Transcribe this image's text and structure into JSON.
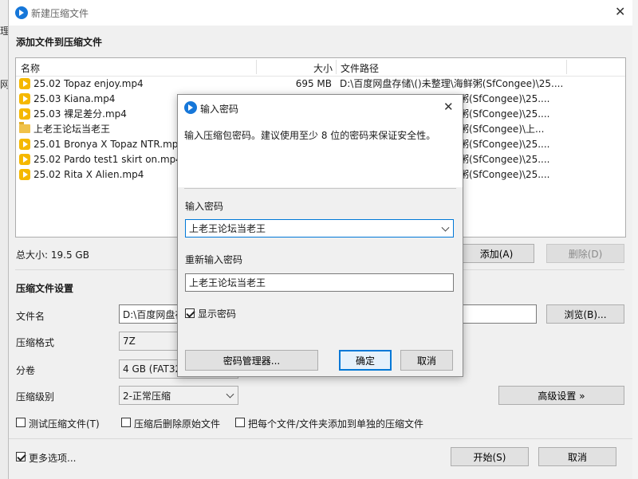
{
  "window": {
    "title": "新建压缩文件",
    "section_add_title": "添加文件到压缩文件",
    "columns": {
      "name": "名称",
      "size": "大小",
      "path": "文件路径"
    },
    "files": [
      {
        "name": "25.02 Topaz enjoy.mp4",
        "size": "695 MB",
        "path": "D:\\百度网盘存储\\()未整理\\海鲜粥(SfCongee)\\25....",
        "icon": "video-icon"
      },
      {
        "name": "25.03 Kiana.mp4",
        "size": "",
        "path": "粥(SfCongee)\\25....",
        "icon": "video-icon"
      },
      {
        "name": "25.03 裸足差分.mp4",
        "size": "",
        "path": "粥(SfCongee)\\25....",
        "icon": "video-icon"
      },
      {
        "name": "上老王论坛当老王",
        "size": "",
        "path": "粥(SfCongee)\\上...",
        "icon": "folder-icon"
      },
      {
        "name": "25.01 Bronya X Topaz NTR.mp4",
        "size": "",
        "path": "粥(SfCongee)\\25....",
        "icon": "video-icon"
      },
      {
        "name": "25.02 Pardo test1 skirt on.mp4",
        "size": "",
        "path": "粥(SfCongee)\\25....",
        "icon": "video-icon"
      },
      {
        "name": "25.02 Rita X Alien.mp4",
        "size": "",
        "path": "粥(SfCongee)\\25....",
        "icon": "video-icon"
      }
    ],
    "total_size": "总大小: 19.5 GB",
    "add_button": "添加(A)",
    "delete_button": "删除(D)",
    "settings_title": "压缩文件设置",
    "filename_label": "文件名",
    "filename_value": "D:\\百度网盘存",
    "browse_button": "浏览(B)...",
    "format_label": "压缩格式",
    "format_value": "7Z",
    "volume_label": "分卷",
    "volume_value": "4 GB (FAT32",
    "level_label": "压缩级别",
    "level_value": "2-正常压缩",
    "advanced_button": "高级设置 »",
    "opt_test": "测试压缩文件(T)",
    "opt_delete": "压缩后删除原始文件",
    "opt_separate": "把每个文件/文件夹添加到单独的压缩文件",
    "more_options": "更多选项...",
    "start_button": "开始(S)",
    "cancel_button": "取消"
  },
  "dialog": {
    "title": "输入密码",
    "description": "输入压缩包密码。建议使用至少 8 位的密码来保证安全性。",
    "password_label": "输入密码",
    "password_value": "上老王论坛当老王",
    "reenter_label": "重新输入密码",
    "reenter_value": "上老王论坛当老王",
    "show_password": "显示密码",
    "show_password_checked": true,
    "manager_button": "密码管理器...",
    "ok_button": "确定",
    "cancel_button": "取消"
  },
  "background": {
    "left_text_1": "网",
    "left_text_2": "理"
  },
  "colors": {
    "accent": "#0078d7",
    "app_icon": "#1677d9",
    "video_icon": "#f5b800",
    "folder_icon": "#f0c24a"
  }
}
